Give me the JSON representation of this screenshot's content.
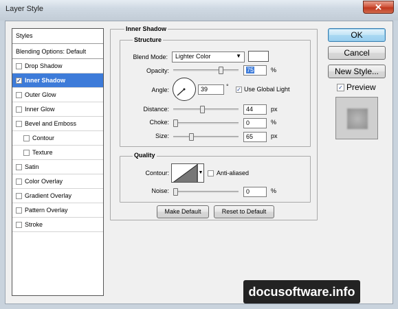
{
  "window": {
    "title": "Layer Style",
    "close_glyph": "✕"
  },
  "styles_panel": {
    "header": "Styles",
    "blending": "Blending Options: Default",
    "items": [
      {
        "label": "Drop Shadow",
        "checked": false,
        "selected": false,
        "indent": false
      },
      {
        "label": "Inner Shadow",
        "checked": true,
        "selected": true,
        "indent": false
      },
      {
        "label": "Outer Glow",
        "checked": false,
        "selected": false,
        "indent": false
      },
      {
        "label": "Inner Glow",
        "checked": false,
        "selected": false,
        "indent": false
      },
      {
        "label": "Bevel and Emboss",
        "checked": false,
        "selected": false,
        "indent": false
      },
      {
        "label": "Contour",
        "checked": false,
        "selected": false,
        "indent": true
      },
      {
        "label": "Texture",
        "checked": false,
        "selected": false,
        "indent": true
      },
      {
        "label": "Satin",
        "checked": false,
        "selected": false,
        "indent": false
      },
      {
        "label": "Color Overlay",
        "checked": false,
        "selected": false,
        "indent": false
      },
      {
        "label": "Gradient Overlay",
        "checked": false,
        "selected": false,
        "indent": false
      },
      {
        "label": "Pattern Overlay",
        "checked": false,
        "selected": false,
        "indent": false
      },
      {
        "label": "Stroke",
        "checked": false,
        "selected": false,
        "indent": false
      }
    ]
  },
  "inner_shadow": {
    "title": "Inner Shadow",
    "structure": {
      "title": "Structure",
      "blend_mode_label": "Blend Mode:",
      "blend_mode_value": "Lighter Color",
      "opacity_label": "Opacity:",
      "opacity_value": "75",
      "opacity_unit": "%",
      "angle_label": "Angle:",
      "angle_value": "39",
      "angle_unit": "°",
      "use_global_light_label": "Use Global Light",
      "use_global_light_checked": true,
      "distance_label": "Distance:",
      "distance_value": "44",
      "distance_unit": "px",
      "choke_label": "Choke:",
      "choke_value": "0",
      "choke_unit": "%",
      "size_label": "Size:",
      "size_value": "65",
      "size_unit": "px"
    },
    "quality": {
      "title": "Quality",
      "contour_label": "Contour:",
      "anti_aliased_label": "Anti-aliased",
      "anti_aliased_checked": false,
      "noise_label": "Noise:",
      "noise_value": "0",
      "noise_unit": "%"
    },
    "make_default_label": "Make Default",
    "reset_default_label": "Reset to Default"
  },
  "actions": {
    "ok_label": "OK",
    "cancel_label": "Cancel",
    "new_style_label": "New Style...",
    "preview_label": "Preview",
    "preview_checked": true
  },
  "sliders": {
    "opacity_fraction": 0.75,
    "distance_fraction": 0.44,
    "choke_fraction": 0.0,
    "size_fraction": 0.26,
    "noise_fraction": 0.0
  },
  "watermark": "docusoftware.info",
  "colors": {
    "selection": "#3d7bd9",
    "window_frame": "#c9d3dd",
    "client_bg": "#f0f0f0"
  }
}
